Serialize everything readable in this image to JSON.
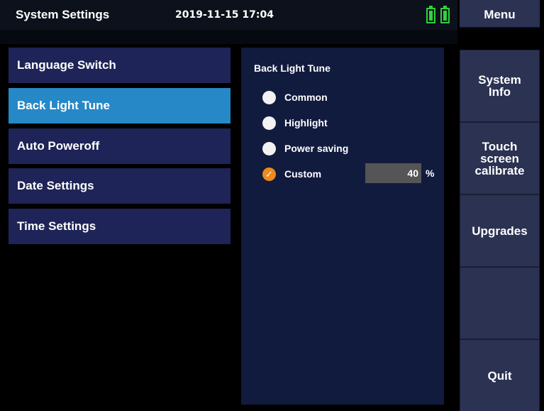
{
  "header": {
    "title": "System Settings",
    "datetime": "2019-11-15 17:04",
    "battery_color": "#2fd33a"
  },
  "sidebar": {
    "items": [
      {
        "label": "Language Switch",
        "active": false
      },
      {
        "label": "Back Light Tune",
        "active": true
      },
      {
        "label": "Auto Poweroff",
        "active": false
      },
      {
        "label": "Date Settings",
        "active": false
      },
      {
        "label": "Time Settings",
        "active": false
      }
    ]
  },
  "panel": {
    "title": "Back Light Tune",
    "options": [
      {
        "label": "Common",
        "selected": false
      },
      {
        "label": "Highlight",
        "selected": false
      },
      {
        "label": "Power saving",
        "selected": false
      },
      {
        "label": "Custom",
        "selected": true
      }
    ],
    "custom_value": "40",
    "custom_unit": "%"
  },
  "menu": {
    "header": "Menu",
    "buttons": [
      {
        "line1": "System",
        "line2": "Info",
        "line3": ""
      },
      {
        "line1": "Touch",
        "line2": "screen",
        "line3": "calibrate"
      },
      {
        "line1": "Upgrades",
        "line2": "",
        "line3": ""
      },
      {
        "line1": "",
        "line2": "",
        "line3": ""
      },
      {
        "line1": "Quit",
        "line2": "",
        "line3": ""
      }
    ]
  },
  "colors": {
    "accent": "#2688c6",
    "nav_bg": "#1e2457",
    "panel_bg": "#111b3e",
    "menu_bg": "#2b3252",
    "radio_checked": "#f08a1c"
  }
}
